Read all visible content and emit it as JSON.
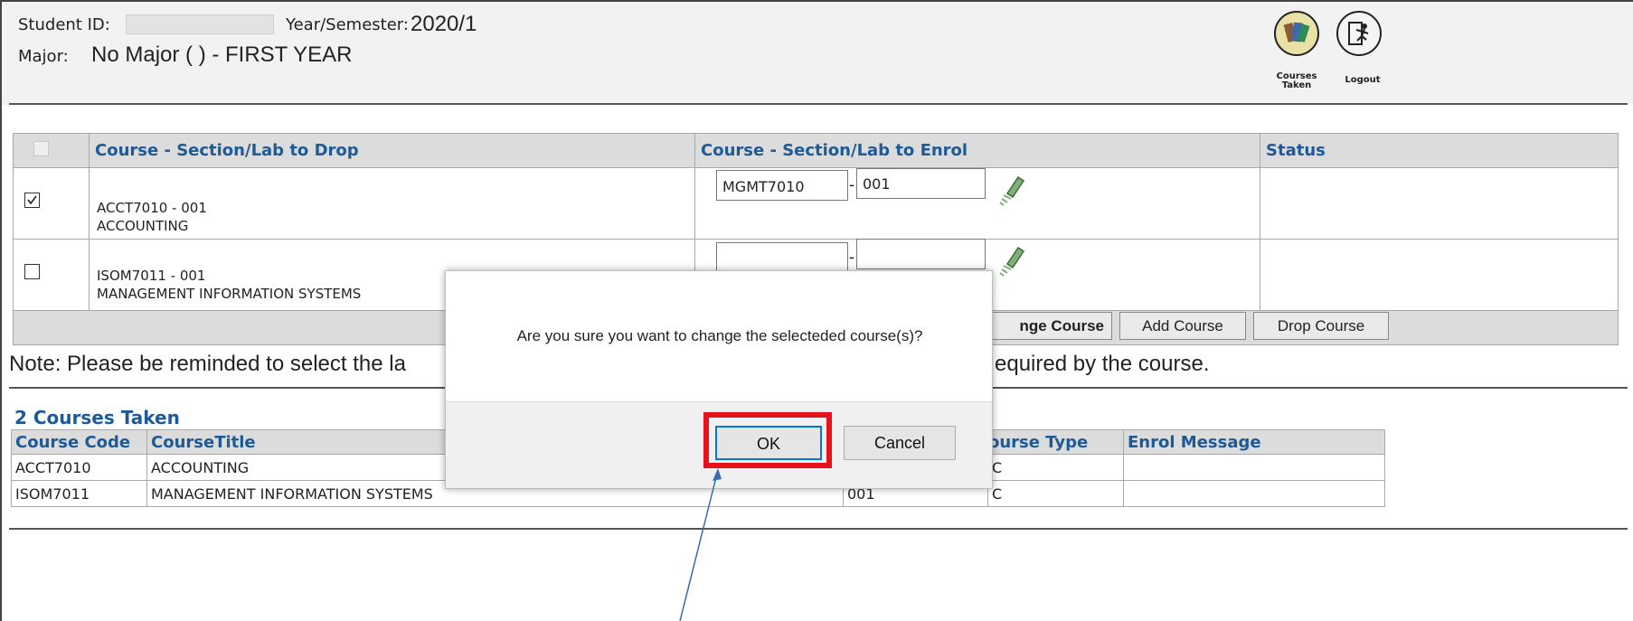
{
  "header": {
    "student_id_label": "Student ID:",
    "student_id_value": "",
    "year_semester_label": "Year/Semester:",
    "year_semester_value": "2020/1",
    "major_label": "Major:",
    "major_value": "No Major ( ) - FIRST YEAR",
    "icons": [
      {
        "name": "courses-taken-icon",
        "caption": "Courses Taken"
      },
      {
        "name": "logout-icon",
        "caption": "Logout"
      }
    ]
  },
  "change_table": {
    "headers": [
      "",
      "Course - Section/Lab to Drop",
      "Course - Section/Lab to Enrol",
      "Status"
    ],
    "rows": [
      {
        "checked": true,
        "drop_code": "ACCT7010 - 001",
        "drop_title": "ACCOUNTING",
        "enrol_course": "MGMT7010",
        "enrol_section": "001",
        "status": ""
      },
      {
        "checked": false,
        "drop_code": "ISOM7011 - 001",
        "drop_title": "MANAGEMENT INFORMATION SYSTEMS",
        "enrol_course": "",
        "enrol_section": "",
        "status": ""
      }
    ],
    "buttons": [
      "nge Course",
      "Add Course",
      "Drop Course"
    ]
  },
  "note": {
    "left": "Note: Please be reminded to select the la",
    "right": "equired by the course."
  },
  "courses_taken": {
    "title": "2 Courses Taken",
    "headers": [
      "Course Code",
      "CourseTitle",
      "",
      "ourse Type",
      "Enrol Message"
    ],
    "rows": [
      [
        "ACCT7010",
        "ACCOUNTING",
        "",
        "C",
        ""
      ],
      [
        "ISOM7011",
        "MANAGEMENT INFORMATION SYSTEMS",
        "001",
        "C",
        ""
      ]
    ]
  },
  "dialog": {
    "message": "Are you sure you want to change the selecteded course(s)?",
    "ok_label": "OK",
    "cancel_label": "Cancel"
  },
  "colors": {
    "header_blue": "#1e5a96",
    "highlight_red": "#e8101a",
    "arrow_blue": "#3a6ab0"
  }
}
